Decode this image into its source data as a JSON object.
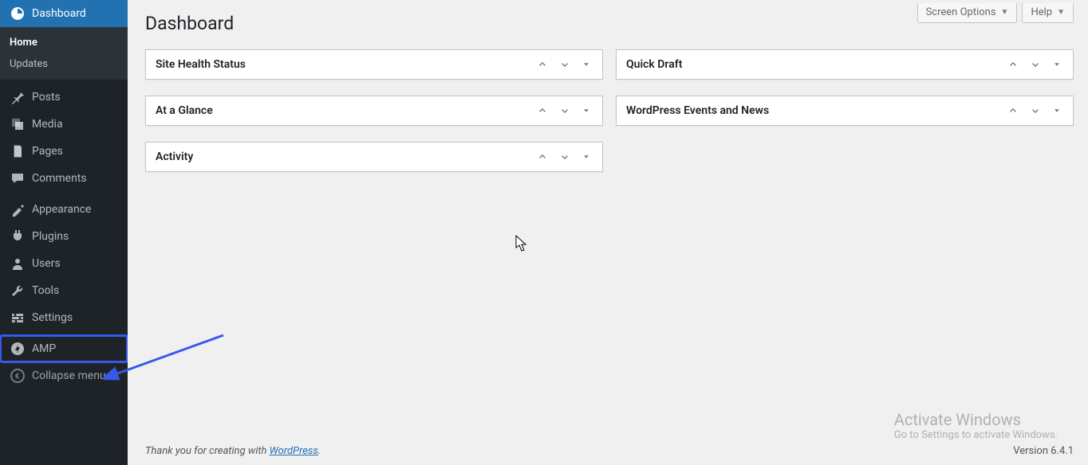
{
  "header": {
    "screen_options": "Screen Options",
    "help": "Help"
  },
  "page": {
    "title": "Dashboard"
  },
  "sidebar": {
    "items": [
      {
        "key": "dashboard",
        "label": "Dashboard"
      },
      {
        "key": "posts",
        "label": "Posts"
      },
      {
        "key": "media",
        "label": "Media"
      },
      {
        "key": "pages",
        "label": "Pages"
      },
      {
        "key": "comments",
        "label": "Comments"
      },
      {
        "key": "appearance",
        "label": "Appearance"
      },
      {
        "key": "plugins",
        "label": "Plugins"
      },
      {
        "key": "users",
        "label": "Users"
      },
      {
        "key": "tools",
        "label": "Tools"
      },
      {
        "key": "settings",
        "label": "Settings"
      },
      {
        "key": "amp",
        "label": "AMP"
      }
    ],
    "submenu": {
      "home": "Home",
      "updates": "Updates"
    },
    "collapse": "Collapse menu"
  },
  "postboxes": {
    "left": [
      {
        "key": "site_health",
        "title": "Site Health Status"
      },
      {
        "key": "at_a_glance",
        "title": "At a Glance"
      },
      {
        "key": "activity",
        "title": "Activity"
      }
    ],
    "right": [
      {
        "key": "quick_draft",
        "title": "Quick Draft"
      },
      {
        "key": "wp_news",
        "title": "WordPress Events and News"
      }
    ]
  },
  "footer": {
    "thank_you_prefix": "Thank you for creating with ",
    "wordpress": "WordPress",
    "thank_you_suffix": ".",
    "version": "Version 6.4.1"
  },
  "watermark": {
    "line1": "Activate Windows",
    "line2": "Go to Settings to activate Windows."
  }
}
